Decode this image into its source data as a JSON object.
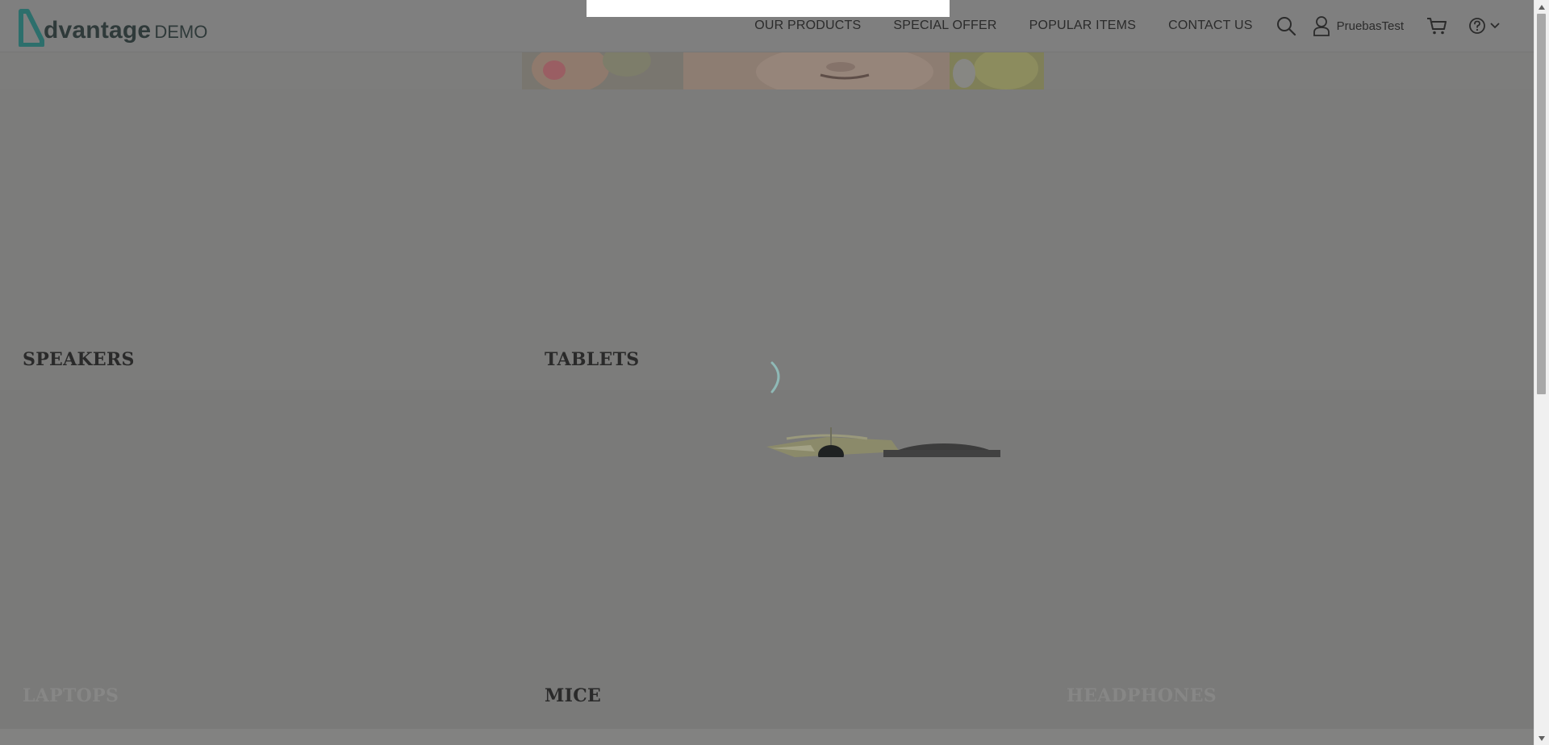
{
  "logo": {
    "word": "dvantage",
    "suffix": "DEMO"
  },
  "nav": {
    "items": [
      {
        "label": "OUR PRODUCTS"
      },
      {
        "label": "SPECIAL OFFER"
      },
      {
        "label": "POPULAR ITEMS"
      },
      {
        "label": "CONTACT US"
      }
    ],
    "user_name": "PruebasTest"
  },
  "categories": {
    "speakers": "SPEAKERS",
    "tablets": "TABLETS",
    "laptops": "LAPTOPS",
    "mice": "MICE",
    "headphones": "HEADPHONES"
  },
  "colors": {
    "overlay": "#7c7c7b",
    "accent": "#2d6f6c",
    "spinner": "#8fb9b6"
  },
  "icons": {
    "search": "search-icon",
    "user": "user-icon",
    "cart": "cart-icon",
    "help": "help-icon",
    "chevron": "chevron-down-icon"
  }
}
